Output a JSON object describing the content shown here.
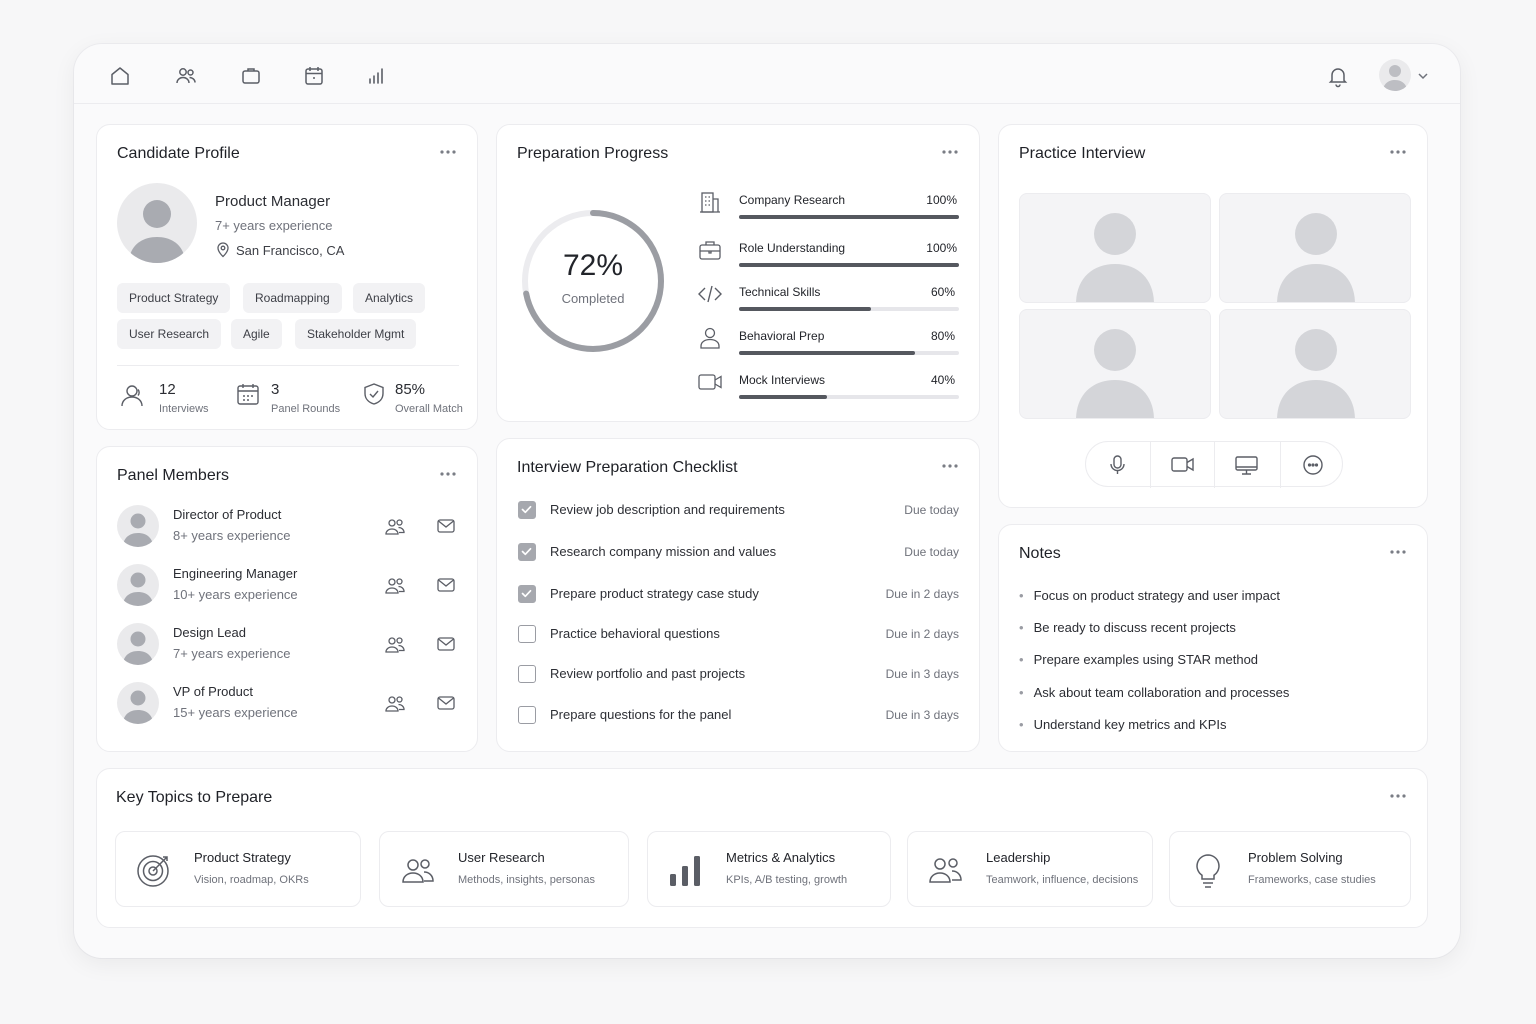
{
  "candidate_profile": {
    "title": "Candidate Profile",
    "role": "Product Manager",
    "experience": "7+ years experience",
    "location": "San Francisco, CA",
    "skills": [
      "Product Strategy",
      "Roadmapping",
      "Analytics",
      "User Research",
      "Agile",
      "Stakeholder Mgmt"
    ],
    "stats": [
      {
        "value": "12",
        "label": "Interviews",
        "icon": "interview-user-icon"
      },
      {
        "value": "3",
        "label": "Panel Rounds",
        "icon": "calendar-icon"
      },
      {
        "value": "85%",
        "label": "Overall Match",
        "icon": "shield-check-icon"
      }
    ]
  },
  "preparation_progress": {
    "title": "Preparation Progress",
    "percent_text": "72%",
    "percent_value": 72,
    "completed_label": "Completed",
    "items": [
      {
        "label": "Company Research",
        "value_text": "100%",
        "value": 100,
        "icon": "building-icon"
      },
      {
        "label": "Role Understanding",
        "value_text": "100%",
        "value": 100,
        "icon": "briefcase-icon"
      },
      {
        "label": "Technical Skills",
        "value_text": "60%",
        "value": 60,
        "icon": "code-icon"
      },
      {
        "label": "Behavioral Prep",
        "value_text": "80%",
        "value": 80,
        "icon": "person-icon"
      },
      {
        "label": "Mock Interviews",
        "value_text": "40%",
        "value": 40,
        "icon": "video-icon"
      }
    ]
  },
  "practice_interview": {
    "title": "Practice Interview",
    "controls": [
      "microphone-icon",
      "camera-icon",
      "screen-share-icon",
      "chat-icon"
    ]
  },
  "panel_members": {
    "title": "Panel Members",
    "members": [
      {
        "role": "Director of Product",
        "experience": "8+ years experience"
      },
      {
        "role": "Engineering Manager",
        "experience": "10+ years experience"
      },
      {
        "role": "Design Lead",
        "experience": "7+ years experience"
      },
      {
        "role": "VP of Product",
        "experience": "15+ years experience"
      }
    ]
  },
  "checklist": {
    "title": "Interview Preparation Checklist",
    "items": [
      {
        "text": "Review job description and requirements",
        "due": "Due today",
        "checked": true
      },
      {
        "text": "Research company mission and values",
        "due": "Due today",
        "checked": true
      },
      {
        "text": "Prepare product strategy case study",
        "due": "Due in 2 days",
        "checked": true
      },
      {
        "text": "Practice behavioral questions",
        "due": "Due in 2 days",
        "checked": false
      },
      {
        "text": "Review portfolio and past projects",
        "due": "Due in 3 days",
        "checked": false
      },
      {
        "text": "Prepare questions for the panel",
        "due": "Due in 3 days",
        "checked": false
      }
    ]
  },
  "notes": {
    "title": "Notes",
    "items": [
      "Focus on product strategy and user impact",
      "Be ready to discuss recent projects",
      "Prepare examples using STAR method",
      "Ask about team collaboration and processes",
      "Understand key metrics and KPIs"
    ]
  },
  "key_topics": {
    "title": "Key Topics to Prepare",
    "topics": [
      {
        "title": "Product Strategy",
        "subtitle": "Vision, roadmap, OKRs",
        "icon": "target-icon"
      },
      {
        "title": "User Research",
        "subtitle": "Methods, insights, personas",
        "icon": "users-icon"
      },
      {
        "title": "Metrics & Analytics",
        "subtitle": "KPIs, A/B testing, growth",
        "icon": "bar-chart-icon"
      },
      {
        "title": "Leadership",
        "subtitle": "Teamwork, influence, decisions",
        "icon": "team-icon"
      },
      {
        "title": "Problem Solving",
        "subtitle": "Frameworks, case studies",
        "icon": "lightbulb-icon"
      }
    ]
  },
  "colors": {
    "accent": "#55585f",
    "track": "#e6e6ea",
    "muted_text": "#6f727b",
    "card_bg": "#ffffff",
    "page_bg": "#f7f7f8"
  }
}
